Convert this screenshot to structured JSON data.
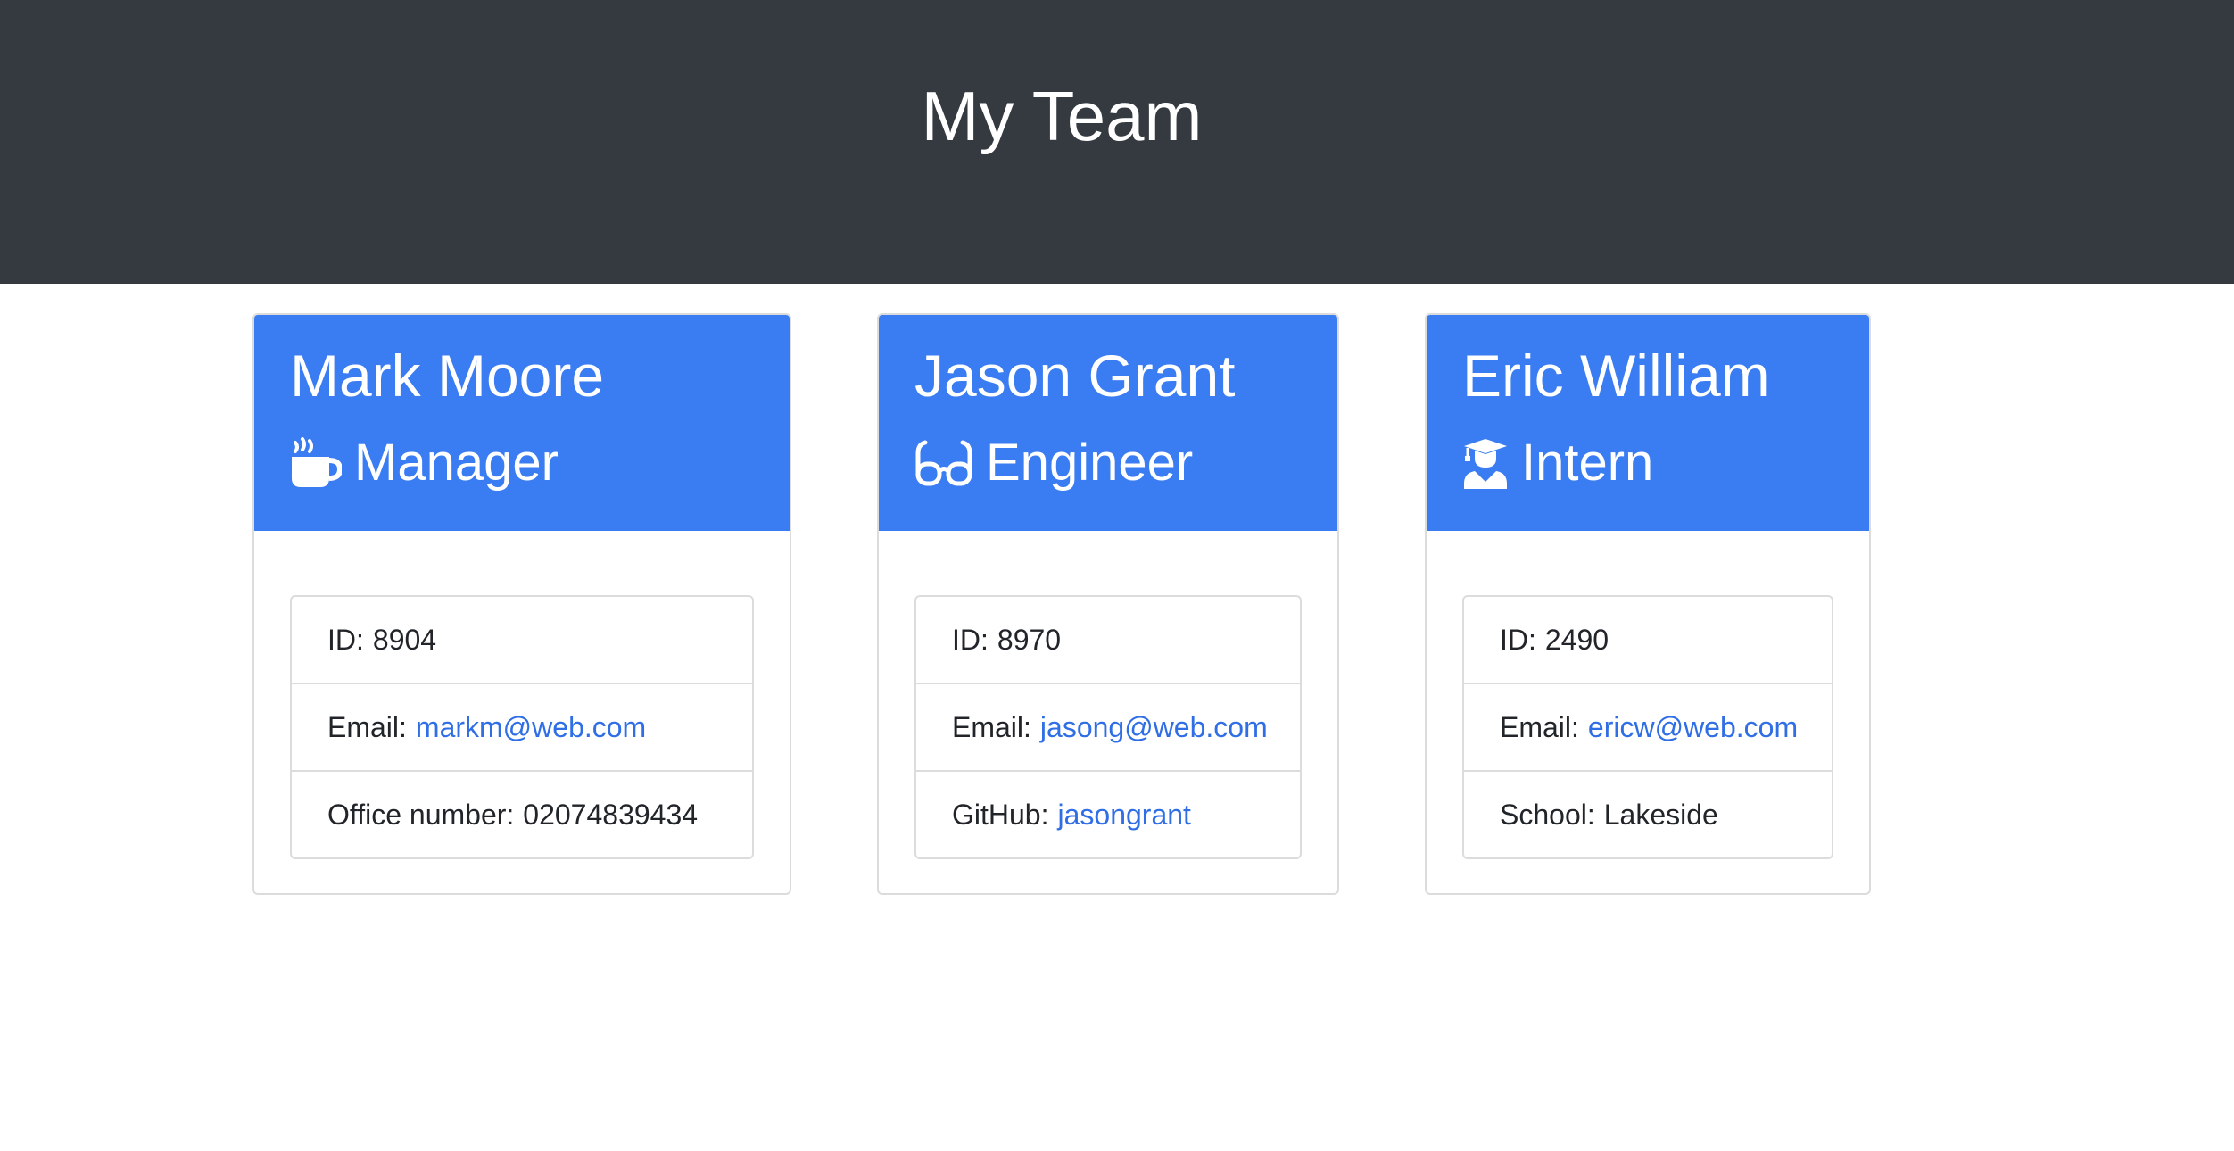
{
  "header": {
    "title": "My Team"
  },
  "cards": [
    {
      "name": "Mark Moore",
      "role": "Manager",
      "role_icon": "coffee-mug-icon",
      "id_label": "ID:",
      "id_value": "8904",
      "email_label": "Email:",
      "email": "markm@web.com",
      "extra_label": "Office number:",
      "extra_value": "02074839434"
    },
    {
      "name": "Jason Grant",
      "role": "Engineer",
      "role_icon": "glasses-icon",
      "id_label": "ID:",
      "id_value": "8970",
      "email_label": "Email:",
      "email": "jasong@web.com",
      "extra_label": "GitHub:",
      "extra_value": "jasongrant"
    },
    {
      "name": "Eric William",
      "role": "Intern",
      "role_icon": "graduate-user-icon",
      "id_label": "ID:",
      "id_value": "2490",
      "email_label": "Email:",
      "email": "ericw@web.com",
      "extra_label": "School:",
      "extra_value": "Lakeside"
    }
  ],
  "colors": {
    "header_bg": "#343a40",
    "card_header_bg": "#3a7cf2",
    "link": "#2f6ee5"
  }
}
